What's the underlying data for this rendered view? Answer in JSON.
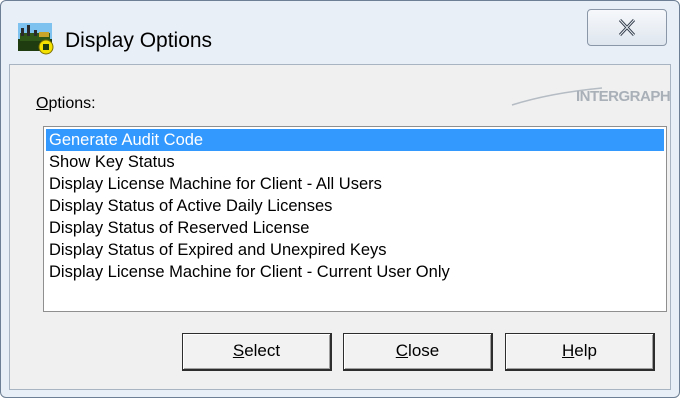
{
  "window": {
    "title": "Display Options",
    "close_icon": "close-x-icon",
    "app_icon": "intergraph-license-app-icon"
  },
  "options": {
    "label": "Options:",
    "logo_text": "INTERGRAPH",
    "items": [
      {
        "label": "Generate Audit Code",
        "selected": true
      },
      {
        "label": "Show Key Status",
        "selected": false
      },
      {
        "label": "Display License Machine for Client - All Users",
        "selected": false
      },
      {
        "label": "Display Status of Active Daily Licenses",
        "selected": false
      },
      {
        "label": "Display Status of Reserved License",
        "selected": false
      },
      {
        "label": "Display Status of Expired and Unexpired Keys",
        "selected": false
      },
      {
        "label": "Display License Machine for Client - Current User Only",
        "selected": false
      }
    ]
  },
  "buttons": {
    "select": {
      "first": "S",
      "rest": "elect"
    },
    "close": {
      "first": "C",
      "rest": "lose"
    },
    "help": {
      "first": "H",
      "rest": "elp"
    }
  },
  "colors": {
    "selection": "#3399ff",
    "window_frame": "#e9eff6",
    "dialog_face": "#f0f0f0"
  }
}
